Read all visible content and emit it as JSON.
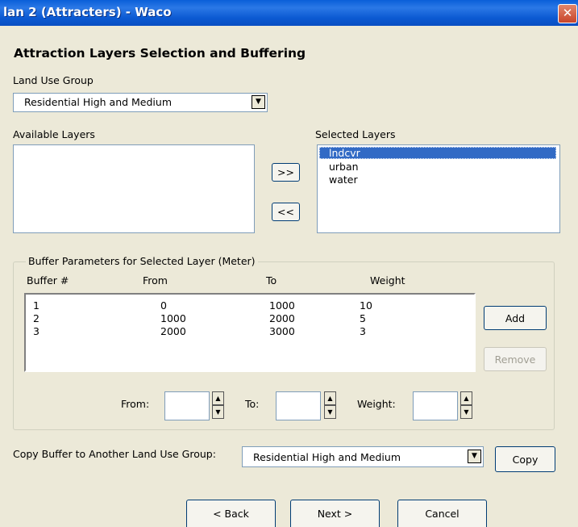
{
  "window": {
    "title": "lan 2 (Attracters) - Waco",
    "close_glyph": "✕"
  },
  "heading": "Attraction Layers Selection and Buffering",
  "land_use": {
    "label": "Land Use Group",
    "selected": "Residential High and Medium"
  },
  "available": {
    "label": "Available Layers",
    "items": []
  },
  "selected_layers": {
    "label": "Selected Layers",
    "items": [
      "lndcvr",
      "urban",
      "water"
    ],
    "highlighted": "lndcvr"
  },
  "move": {
    "right": ">>",
    "left": "<<"
  },
  "buffer": {
    "group_label": "Buffer Parameters for Selected Layer (Meter)",
    "columns": [
      "Buffer #",
      "From",
      "To",
      "Weight"
    ],
    "rows": [
      [
        "1",
        "0",
        "1000",
        "10"
      ],
      [
        "2",
        "1000",
        "2000",
        "5"
      ],
      [
        "3",
        "2000",
        "3000",
        "3"
      ]
    ],
    "add": "Add",
    "remove": "Remove",
    "from_label": "From:",
    "to_label": "To:",
    "weight_label": "Weight:",
    "from_value": "",
    "to_value": "",
    "weight_value": ""
  },
  "copy": {
    "label": "Copy Buffer to Another Land Use Group:",
    "selected": "Residential High and Medium",
    "button": "Copy"
  },
  "nav": {
    "back": "< Back",
    "next": "Next >",
    "cancel": "Cancel"
  },
  "colors": {
    "titlebar": "#0a5fd8",
    "dialog_bg": "#ece9d8",
    "selection": "#316ac5"
  }
}
